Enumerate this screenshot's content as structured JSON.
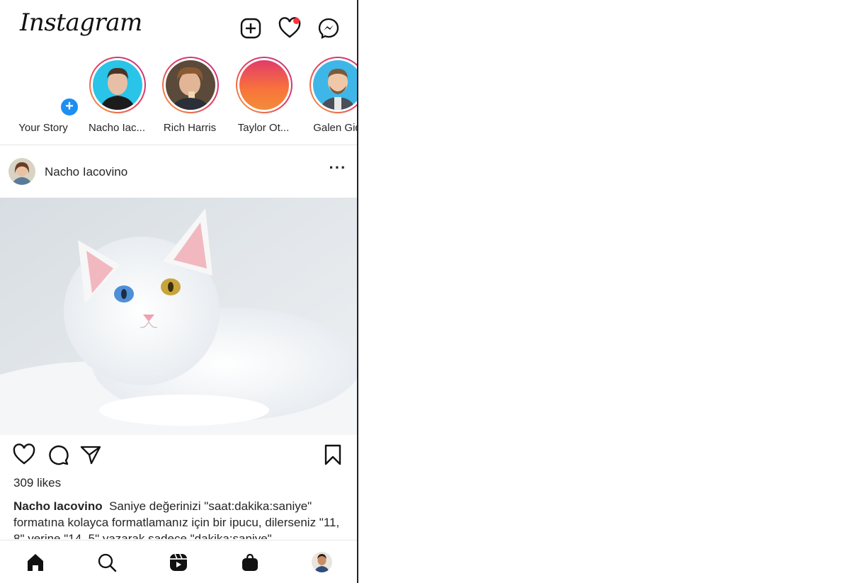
{
  "header": {
    "logo": "Instagram",
    "icons": [
      "new-post-icon",
      "heart-icon",
      "messenger-icon"
    ],
    "notification_dot_color": "#ff3040"
  },
  "stories": [
    {
      "label": "Your Story",
      "is_own": true
    },
    {
      "label": "Nacho Iac..."
    },
    {
      "label": "Rich Harris"
    },
    {
      "label": "Taylor Ot..."
    },
    {
      "label": "Galen Gid"
    }
  ],
  "post": {
    "username": "Nacho Iacovino",
    "likes": "309 likes",
    "caption_user": "Nacho Iacovino",
    "caption_text": "Saniye değerinizi \"saat:dakika:saniye\" formatına kolayca formatlamanız için bir ipucu, dilerseniz \"11, 8\" yerine \"14, 5\" yazarak sadece \"dakika:saniye\""
  },
  "actions": [
    "like-icon",
    "comment-icon",
    "share-icon",
    "bookmark-icon"
  ],
  "bottom_nav": [
    "home-icon",
    "search-icon",
    "reels-icon",
    "shop-icon",
    "profile-avatar"
  ],
  "colors": {
    "story_ring_start": "#f9a13a",
    "story_ring_end": "#c13584",
    "add_story_blue": "#1d8ff2"
  }
}
